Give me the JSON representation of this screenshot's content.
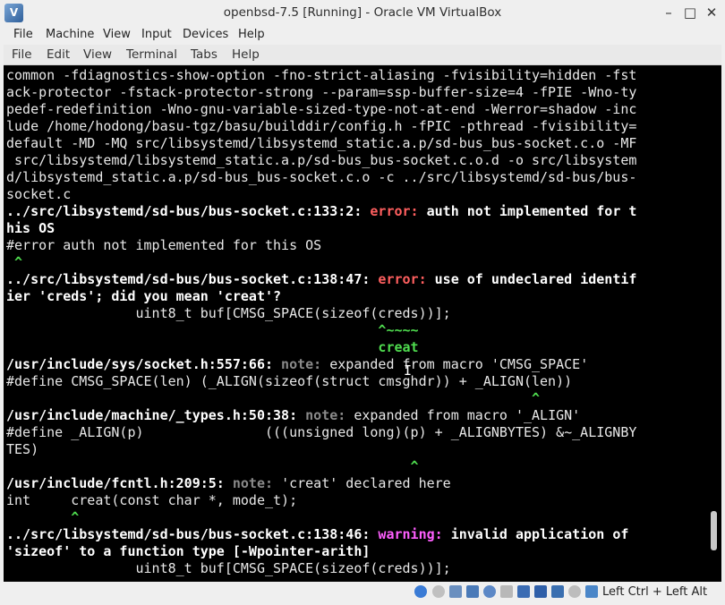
{
  "window": {
    "title": "openbsd-7.5 [Running] - Oracle VM VirtualBox",
    "minimize_glyph": "–",
    "maximize_glyph": "□",
    "close_glyph": "✕"
  },
  "vbox_menu": [
    "File",
    "Machine",
    "View",
    "Input",
    "Devices",
    "Help"
  ],
  "terminal_menu": [
    "File",
    "Edit",
    "View",
    "Terminal",
    "Tabs",
    "Help"
  ],
  "terminal": {
    "lines": [
      [
        {
          "t": "common -fdiagnostics-show-option -fno-strict-aliasing -fvisibility=hidden -fst",
          "c": ""
        }
      ],
      [
        {
          "t": "ack-protector -fstack-protector-strong --param=ssp-buffer-size=4 -fPIE -Wno-ty",
          "c": ""
        }
      ],
      [
        {
          "t": "pedef-redefinition -Wno-gnu-variable-sized-type-not-at-end -Werror=shadow -inc",
          "c": ""
        }
      ],
      [
        {
          "t": "lude /home/hodong/basu-tgz/basu/builddir/config.h -fPIC -pthread -fvisibility=",
          "c": ""
        }
      ],
      [
        {
          "t": "default -MD -MQ src/libsystemd/libsystemd_static.a.p/sd-bus_bus-socket.c.o -MF",
          "c": ""
        }
      ],
      [
        {
          "t": " src/libsystemd/libsystemd_static.a.p/sd-bus_bus-socket.c.o.d -o src/libsystem",
          "c": ""
        }
      ],
      [
        {
          "t": "d/libsystemd_static.a.p/sd-bus_bus-socket.c.o -c ../src/libsystemd/sd-bus/bus-",
          "c": ""
        }
      ],
      [
        {
          "t": "socket.c",
          "c": ""
        }
      ],
      [
        {
          "t": "../src/libsystemd/sd-bus/bus-socket.c:133:2: ",
          "c": "b"
        },
        {
          "t": "error: ",
          "c": "err"
        },
        {
          "t": "auth not implemented for t",
          "c": "b"
        }
      ],
      [
        {
          "t": "his OS",
          "c": "b"
        }
      ],
      [
        {
          "t": "#error auth not implemented for this OS",
          "c": ""
        }
      ],
      [
        {
          "t": " ^",
          "c": "grn"
        }
      ],
      [
        {
          "t": "../src/libsystemd/sd-bus/bus-socket.c:138:47: ",
          "c": "b"
        },
        {
          "t": "error: ",
          "c": "err"
        },
        {
          "t": "use of undeclared identif",
          "c": "b"
        }
      ],
      [
        {
          "t": "ier 'creds'; did you mean 'creat'?",
          "c": "b"
        }
      ],
      [
        {
          "t": "                uint8_t buf[CMSG_SPACE(sizeof(creds))];",
          "c": ""
        }
      ],
      [
        {
          "t": "                                              ^~~~~",
          "c": "grn"
        }
      ],
      [
        {
          "t": "                                              creat",
          "c": "grn"
        }
      ],
      [
        {
          "t": "/usr/include/sys/socket.h:557:66: ",
          "c": "b"
        },
        {
          "t": "note: ",
          "c": "note"
        },
        {
          "t": "expanded from macro 'CMSG_SPACE'",
          "c": ""
        }
      ],
      [
        {
          "t": "#define CMSG_SPACE(len) (_ALIGN(sizeof(struct cmsghdr)) + _ALIGN(len))",
          "c": ""
        }
      ],
      [
        {
          "t": "                                                                 ^",
          "c": "grn"
        }
      ],
      [
        {
          "t": "/usr/include/machine/_types.h:50:38: ",
          "c": "b"
        },
        {
          "t": "note: ",
          "c": "note"
        },
        {
          "t": "expanded from macro '_ALIGN'",
          "c": ""
        }
      ],
      [
        {
          "t": "#define _ALIGN(p)               (((unsigned long)(p) + _ALIGNBYTES) &~_ALIGNBY",
          "c": ""
        }
      ],
      [
        {
          "t": "TES)",
          "c": ""
        }
      ],
      [
        {
          "t": "                                                  ^",
          "c": "grn"
        }
      ],
      [
        {
          "t": "/usr/include/fcntl.h:209:5: ",
          "c": "b"
        },
        {
          "t": "note: ",
          "c": "note"
        },
        {
          "t": "'creat' declared here",
          "c": ""
        }
      ],
      [
        {
          "t": "int     creat(const char *, mode_t);",
          "c": ""
        }
      ],
      [
        {
          "t": "        ^",
          "c": "grn"
        }
      ],
      [
        {
          "t": "../src/libsystemd/sd-bus/bus-socket.c:138:46: ",
          "c": "b"
        },
        {
          "t": "warning: ",
          "c": "warn"
        },
        {
          "t": "invalid application of",
          "c": "b"
        }
      ],
      [
        {
          "t": "'sizeof' to a function type [-Wpointer-arith]",
          "c": "b"
        }
      ],
      [
        {
          "t": "                uint8_t buf[CMSG_SPACE(sizeof(creds))];",
          "c": ""
        }
      ]
    ]
  },
  "statusbar": {
    "icons": [
      "harddisk-icon",
      "optical-disk-icon",
      "audio-icon",
      "network-icon",
      "usb-icon",
      "shared-folders-icon",
      "display-icon",
      "video-capture-icon",
      "recording-icon",
      "cpu-icon",
      "mouse-integration-icon",
      "keyboard-icon"
    ],
    "host_key": "Left Ctrl + Left Alt"
  },
  "colors": {
    "accent": "#3a6fb0",
    "error": "#ff5f5f",
    "warning": "#ff5fff",
    "caret": "#4fdc4f",
    "note": "#8a8a8a"
  }
}
